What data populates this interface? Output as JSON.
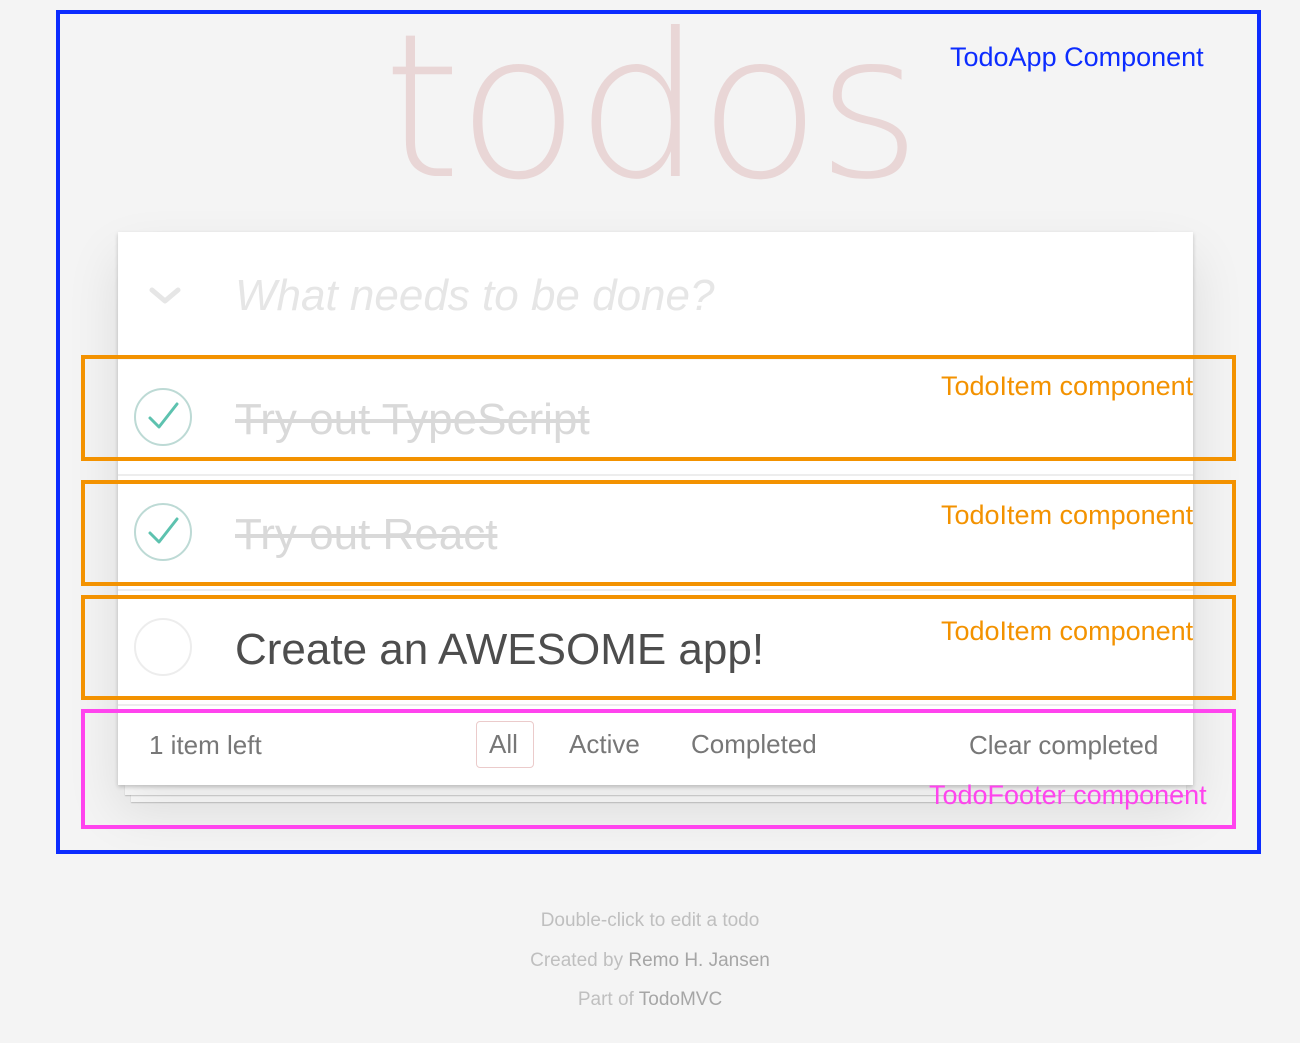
{
  "app": {
    "title": "todos"
  },
  "new_todo": {
    "placeholder": "What needs to be done?",
    "toggle_all_icon": "chevron-down-icon"
  },
  "todos": [
    {
      "text": "Try out TypeScript",
      "completed": true
    },
    {
      "text": "Try out React",
      "completed": true
    },
    {
      "text": "Create an AWESOME app!",
      "completed": false
    }
  ],
  "footer": {
    "count": "1 item left",
    "filters": [
      "All",
      "Active",
      "Completed"
    ],
    "selected_filter": "All",
    "clear_completed": "Clear completed"
  },
  "info": {
    "edit_hint": "Double-click to edit a todo",
    "created_by_prefix": "Created by",
    "author": "Remo H. Jansen",
    "part_of_prefix": "Part of",
    "project": "TodoMVC"
  },
  "annotations": {
    "app_component": "TodoApp Component",
    "item_component": "TodoItem component",
    "footer_component": "TodoFooter component"
  },
  "colors": {
    "app_annotation": "#0c2cff",
    "item_annotation": "#f39200",
    "footer_annotation": "#ff44ee",
    "title": "rgba(175,47,47,0.15)",
    "check_green": "#5dc2af",
    "check_ring": "#bddad5",
    "empty_ring": "#ededed"
  }
}
